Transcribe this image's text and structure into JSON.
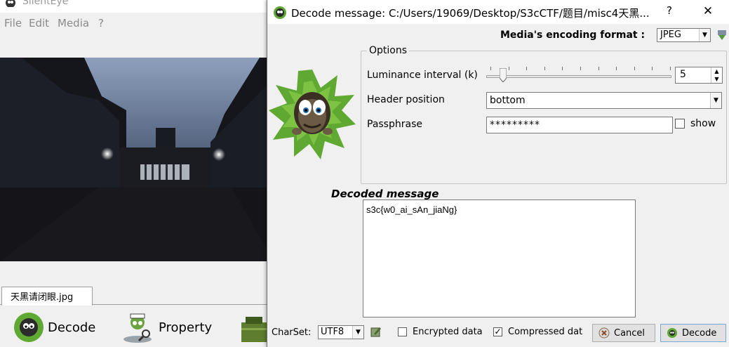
{
  "main_window": {
    "title": "SilentEye",
    "menu": [
      "File",
      "Edit",
      "Media",
      "?"
    ],
    "file_tab": "天黑请闭眼.jpg",
    "toolbar": {
      "decode_label": "Decode",
      "property_label": "Property"
    }
  },
  "dialog": {
    "title": "Decode message: C:/Users/19069/Desktop/S3cCTF/题目/misc4天黑...",
    "help_label": "?",
    "close_label": "✕",
    "format_label": "Media's encoding format :",
    "format_value": "JPEG",
    "options": {
      "legend": "Options",
      "luminance_label": "Luminance interval (k)",
      "luminance_value": "5",
      "luminance_level": 0.05,
      "header_label": "Header position",
      "header_value": "bottom",
      "passphrase_label": "Passphrase",
      "passphrase_value": "*********",
      "show_label": "show",
      "show_checked": false
    },
    "decoded": {
      "label": "Decoded message",
      "text": "s3c{w0_ai_sAn_jiaNg}"
    },
    "bottom": {
      "charset_label": "CharSet:",
      "charset_value": "UTF8",
      "encrypted_label": "Encrypted data",
      "encrypted_checked": false,
      "compressed_label": "Compressed dat",
      "compressed_checked": true,
      "cancel_label": "Cancel",
      "decode_label": "Decode"
    }
  },
  "colors": {
    "mascot_green": "#5fa832",
    "focus_blue": "#7aa8d8"
  }
}
